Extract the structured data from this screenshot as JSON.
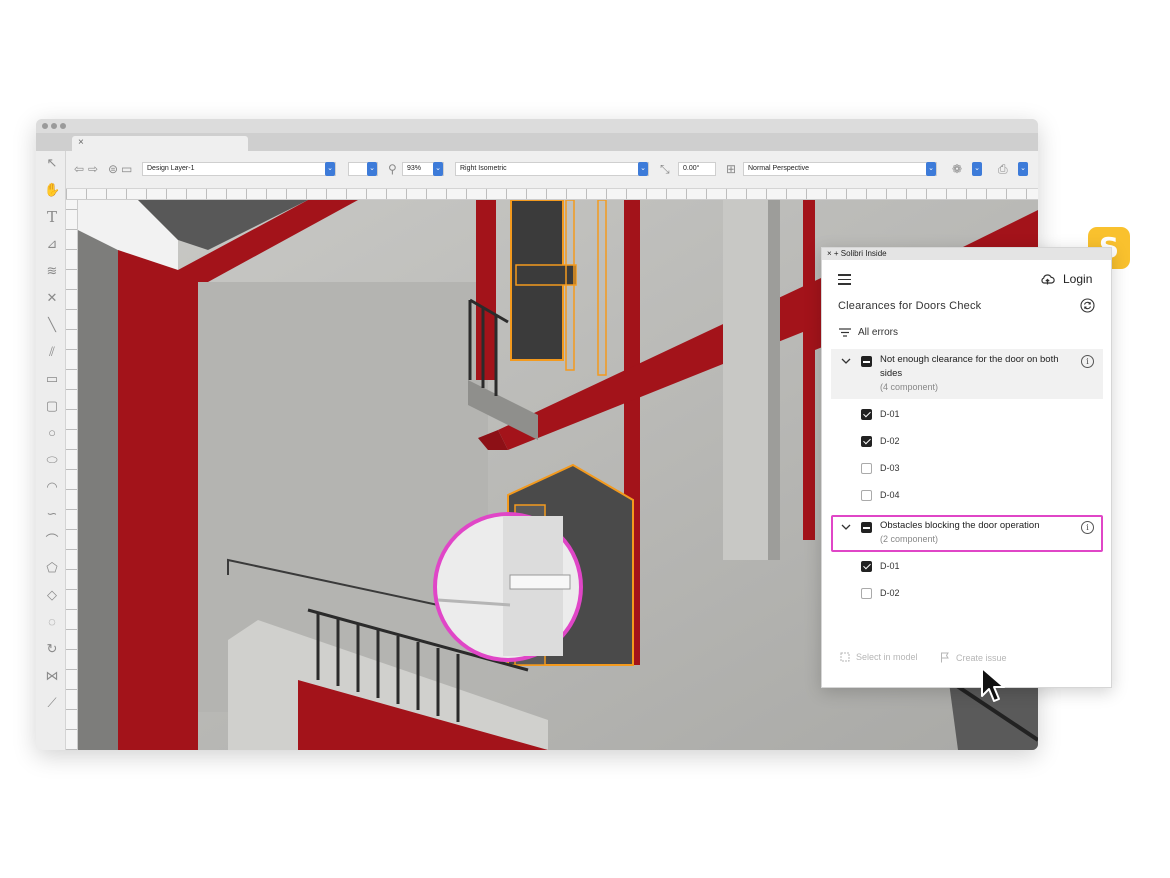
{
  "app": {
    "tab_close": "×",
    "toolbar": {
      "layer_select": "Design Layer-1",
      "zoom_value": "93%",
      "view_select": "Right Isometric",
      "rotation_value": "0.00°",
      "perspective_select": "Normal Perspective"
    }
  },
  "plugin": {
    "title": "× + Solibri Inside",
    "login_label": "Login",
    "check_title": "Clearances for Doors Check",
    "filter_label": "All errors",
    "groups": [
      {
        "title": "Not enough clearance for the door on both sides",
        "count": "(4 component)",
        "items": [
          {
            "label": "D-01",
            "checked": true
          },
          {
            "label": "D-02",
            "checked": true
          },
          {
            "label": "D-03",
            "checked": false
          },
          {
            "label": "D-04",
            "checked": false
          }
        ]
      },
      {
        "title": "Obstacles blocking the door operation",
        "count": "(2 component)",
        "items": [
          {
            "label": "D-01",
            "checked": true
          },
          {
            "label": "D-02",
            "checked": false
          }
        ]
      }
    ],
    "select_in_model": "Select in model",
    "create_issue": "Create issue",
    "badge_letter": "S"
  },
  "colors": {
    "accent_blue": "#3d7bd9",
    "wall_red": "#a3131a",
    "highlight_magenta": "#e046c7",
    "door_orange": "#f39a1e",
    "badge_yellow": "#f9c12e"
  }
}
